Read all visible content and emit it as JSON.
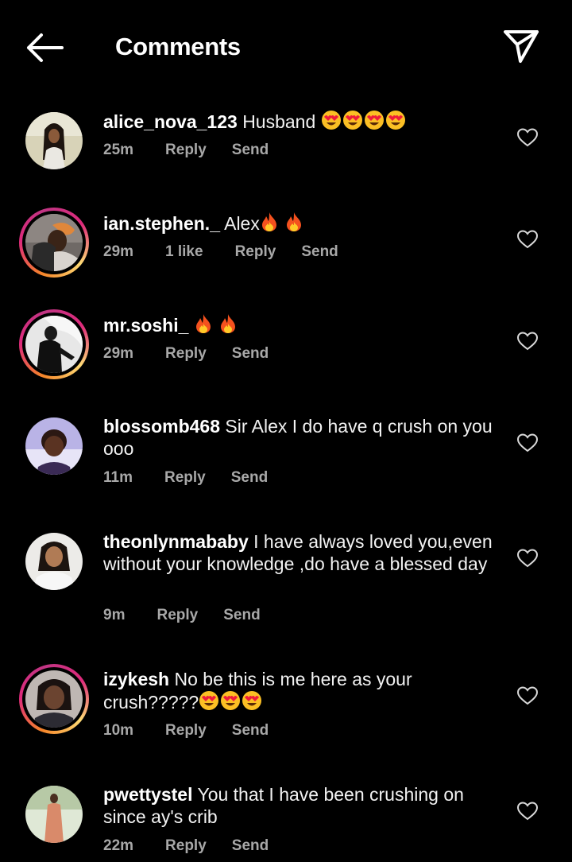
{
  "header": {
    "title": "Comments"
  },
  "comments": [
    {
      "username": "alice_nova_123",
      "text": "Husband",
      "emojis": [
        "heart-eyes",
        "heart-eyes",
        "heart-eyes",
        "heart-eyes"
      ],
      "time": "25m",
      "likes": "",
      "reply": "Reply",
      "send": "Send",
      "has_story": false
    },
    {
      "username": "ian.stephen._",
      "text": "Alex",
      "emojis": [
        "fire",
        "fire"
      ],
      "time": "29m",
      "likes": "1 like",
      "reply": "Reply",
      "send": "Send",
      "has_story": true
    },
    {
      "username": "mr.soshi_",
      "text": "",
      "emojis": [
        "fire",
        "fire"
      ],
      "time": "29m",
      "likes": "",
      "reply": "Reply",
      "send": "Send",
      "has_story": true
    },
    {
      "username": "blossomb468",
      "text": "Sir Alex I do have q crush on you ooo",
      "emojis": [],
      "time": "11m",
      "likes": "",
      "reply": "Reply",
      "send": "Send",
      "has_story": false
    },
    {
      "username": "theonlynmababy",
      "text": "I have always loved you,even without your knowledge ,do have a blessed day",
      "emojis": [],
      "time": "9m",
      "likes": "",
      "reply": "Reply",
      "send": "Send",
      "has_story": false
    },
    {
      "username": "izykesh",
      "text": "No be this is me here as your crush?????",
      "emojis": [
        "heart-eyes",
        "heart-eyes",
        "heart-eyes"
      ],
      "time": "10m",
      "likes": "",
      "reply": "Reply",
      "send": "Send",
      "has_story": true
    },
    {
      "username": "pwettystel",
      "text": "You that I have been crushing on since ay's crib",
      "emojis": [],
      "time": "22m",
      "likes": "",
      "reply": "Reply",
      "send": "Send",
      "has_story": false
    }
  ],
  "icons": {
    "back": "arrow-left-icon",
    "share": "paper-plane-icon",
    "like": "heart-outline-icon"
  },
  "colors": {
    "background": "#000000",
    "text": "#ffffff",
    "meta": "#a8a8a8",
    "story_ring": [
      "#feda75",
      "#f58529",
      "#dd2a7b",
      "#c13584"
    ]
  }
}
